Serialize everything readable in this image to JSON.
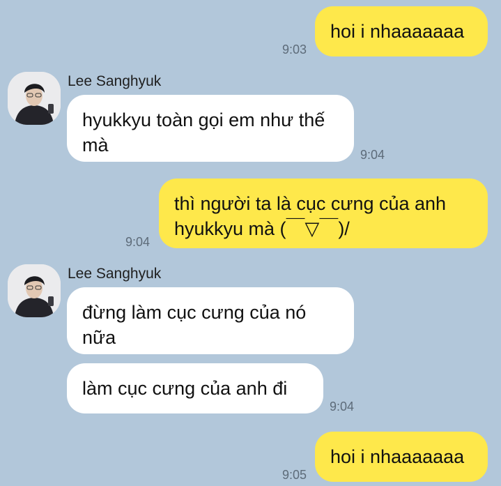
{
  "chat": {
    "messages": [
      {
        "sender": "me",
        "text": "hoi i nhaaaaaaa",
        "time": "9:03"
      },
      {
        "sender": "Lee Sanghyuk",
        "text": "hyukkyu toàn gọi em như thế mà",
        "time": "9:04"
      },
      {
        "sender": "me",
        "text": "thì người ta là cục cưng của anh hyukkyu mà (￣▽￣)/",
        "time": "9:04"
      },
      {
        "sender": "Lee Sanghyuk",
        "text": "đừng làm cục cưng của nó nữa"
      },
      {
        "sender": "Lee Sanghyuk",
        "text": "làm cục cưng của anh đi",
        "time": "9:04"
      },
      {
        "sender": "me",
        "text": "hoi i nhaaaaaaa",
        "time": "9:05"
      }
    ]
  },
  "colors": {
    "background": "#b2c7da",
    "my_bubble": "#fee84b",
    "their_bubble": "#ffffff"
  },
  "icons": {
    "avatar": "profile-photo-avatar"
  }
}
